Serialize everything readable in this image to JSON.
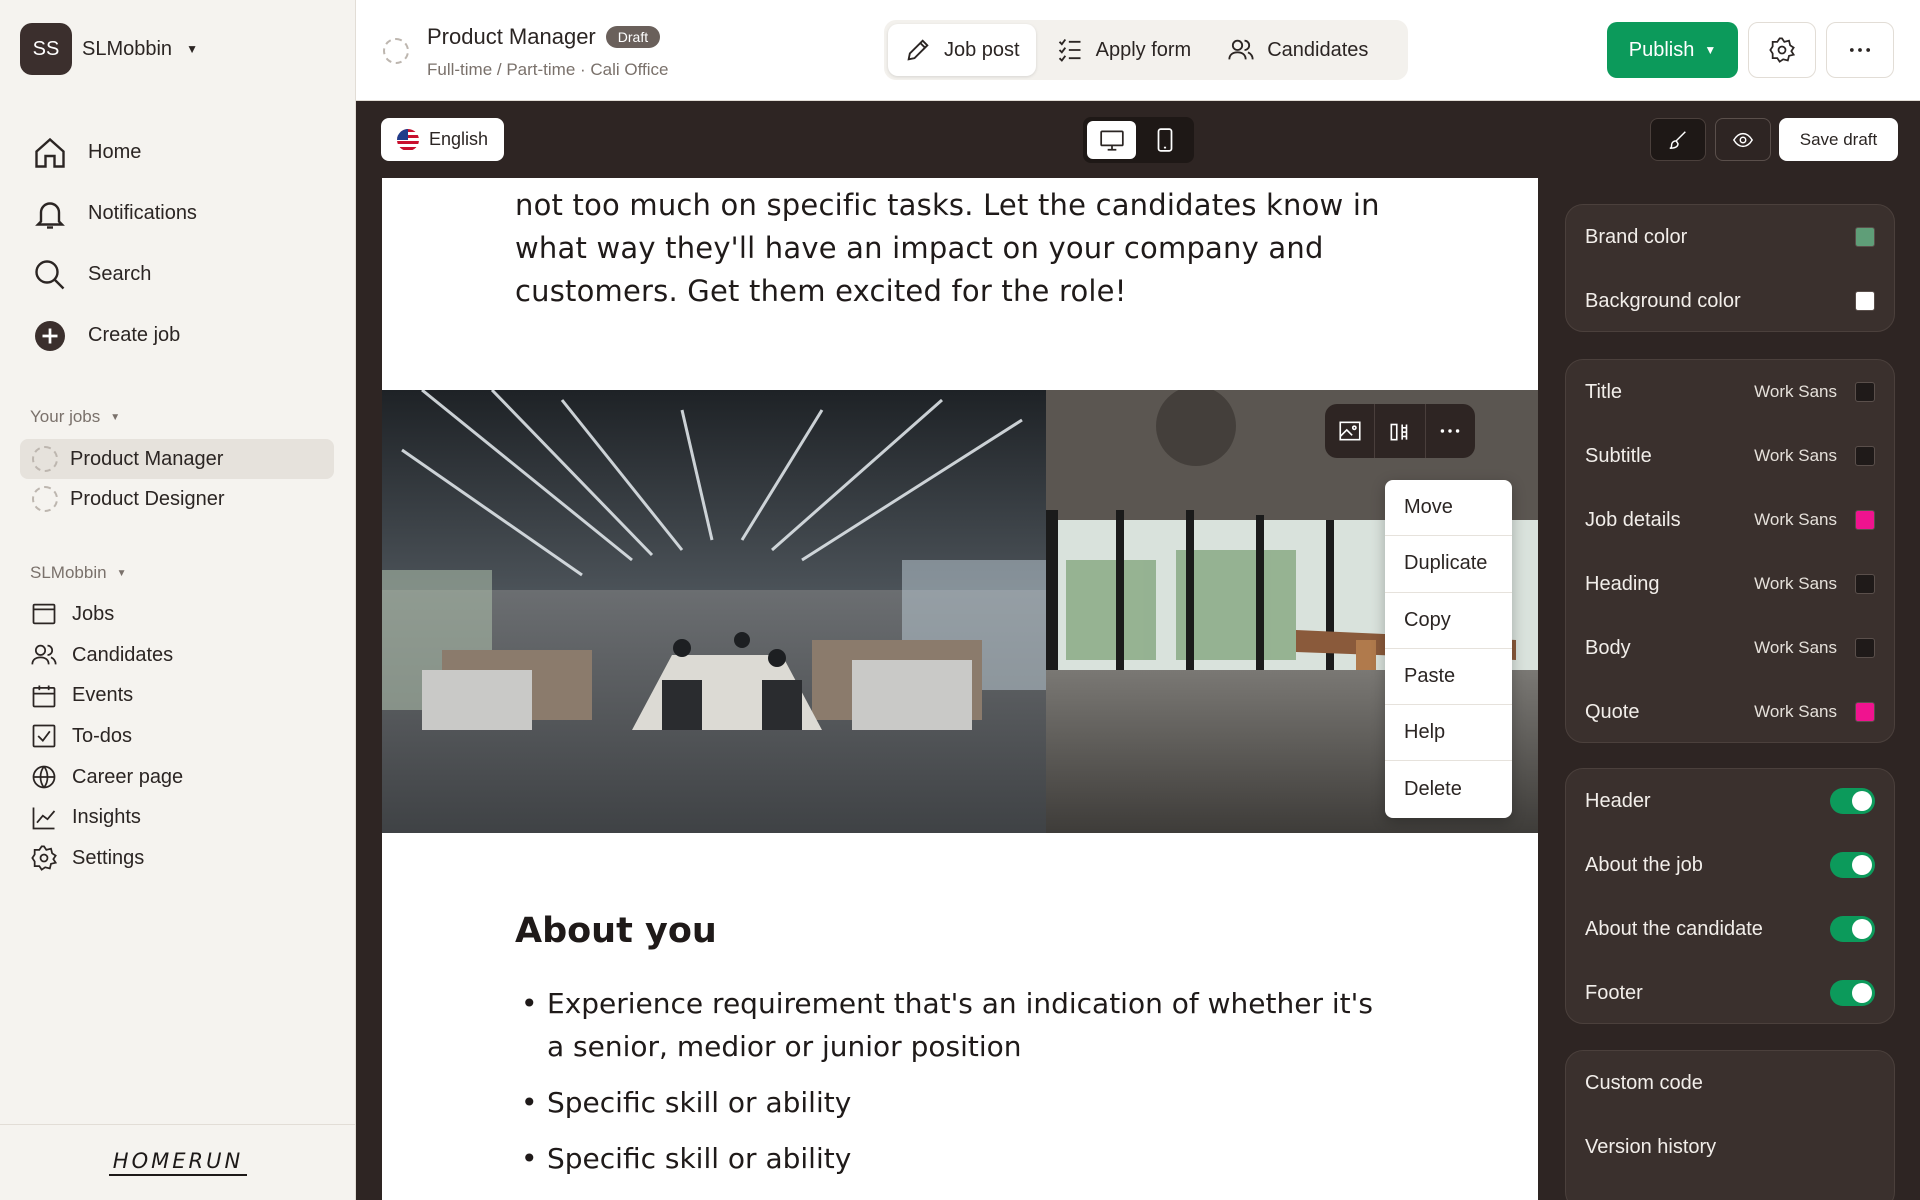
{
  "workspace": {
    "initials": "SS",
    "name": "SLMobbin"
  },
  "nav_main": [
    {
      "label": "Home",
      "icon": "home-icon"
    },
    {
      "label": "Notifications",
      "icon": "bell-icon"
    },
    {
      "label": "Search",
      "icon": "search-icon"
    },
    {
      "label": "Create job",
      "icon": "plus-circle-icon"
    }
  ],
  "your_jobs": {
    "label": "Your jobs",
    "items": [
      {
        "label": "Product Manager",
        "active": true
      },
      {
        "label": "Product Designer",
        "active": false
      }
    ]
  },
  "org": {
    "label": "SLMobbin",
    "items": [
      {
        "label": "Jobs",
        "icon": "browser-icon"
      },
      {
        "label": "Candidates",
        "icon": "users-icon"
      },
      {
        "label": "Events",
        "icon": "calendar-icon"
      },
      {
        "label": "To-dos",
        "icon": "checkbox-icon"
      },
      {
        "label": "Career page",
        "icon": "globe-icon"
      },
      {
        "label": "Insights",
        "icon": "chart-icon"
      },
      {
        "label": "Settings",
        "icon": "gear-icon"
      }
    ]
  },
  "brand": {
    "logo_text": "HOMERUN"
  },
  "header": {
    "job_title": "Product Manager",
    "status_badge": "Draft",
    "job_meta": "Full-time / Part-time · Cali Office",
    "tabs": [
      {
        "label": "Job post",
        "icon": "pencil-icon",
        "active": true
      },
      {
        "label": "Apply form",
        "icon": "checklist-icon",
        "active": false
      },
      {
        "label": "Candidates",
        "icon": "users-icon",
        "active": false
      }
    ],
    "publish_label": "Publish"
  },
  "editor_bar": {
    "language": "English",
    "save_draft": "Save draft"
  },
  "content": {
    "intro": "not too much on specific tasks. Let the candidates know in what way they'll have an impact on your company and customers. Get them excited for the role!",
    "about_title": "About you",
    "bullets": [
      "Experience requirement that's an indication of whether it's a senior, medior or junior position",
      "Specific skill or ability",
      "Specific skill or ability"
    ]
  },
  "context_menu": [
    "Move",
    "Duplicate",
    "Copy",
    "Paste",
    "Help",
    "Delete"
  ],
  "panel_colors": [
    {
      "label": "Brand color",
      "color": "#5f9e78"
    },
    {
      "label": "Background color",
      "color": "#ffffff"
    }
  ],
  "panel_fonts": [
    {
      "label": "Title",
      "font": "Work Sans",
      "color": "#1f1a19"
    },
    {
      "label": "Subtitle",
      "font": "Work Sans",
      "color": "#1f1a19"
    },
    {
      "label": "Job details",
      "font": "Work Sans",
      "color": "#f0138f"
    },
    {
      "label": "Heading",
      "font": "Work Sans",
      "color": "#1f1a19"
    },
    {
      "label": "Body",
      "font": "Work Sans",
      "color": "#1f1a19"
    },
    {
      "label": "Quote",
      "font": "Work Sans",
      "color": "#f0138f"
    }
  ],
  "panel_sections": [
    {
      "label": "Header",
      "on": true
    },
    {
      "label": "About the job",
      "on": true
    },
    {
      "label": "About the candidate",
      "on": true
    },
    {
      "label": "Footer",
      "on": true
    }
  ],
  "panel_extra": [
    "Custom code",
    "Version history"
  ],
  "theme": {
    "accent": "#0c9a5b",
    "dark": "#2e2523",
    "sidebar_bg": "#f5f3ef"
  }
}
